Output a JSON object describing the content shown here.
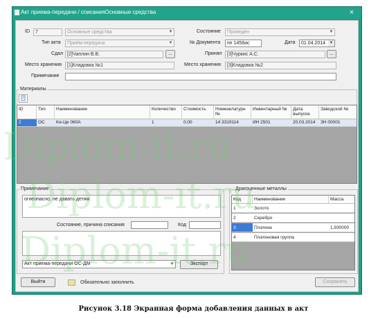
{
  "window": {
    "title": "Акт приема-передачи / списанияОсновные средства",
    "close": "×"
  },
  "form": {
    "id_label": "ID",
    "id_value": "7",
    "type_value": "Основные средства",
    "state_label": "Состояние",
    "state_value": "Проведен",
    "act_type_label": "Тип акта",
    "act_type_value": "Приём-передача",
    "doc_no_label": "№ Документа",
    "doc_no_value": "пп 1456ис",
    "date_label": "Дата",
    "date_value": "01.04.2014",
    "handed_label": "Сдал",
    "handed_value": "[2]Чаплин В.В.",
    "received_label": "Принял",
    "received_value": "[3]Чуркис А.С.",
    "storage_from_label": "Место хранения",
    "storage_from_value": "[1]Кладовка №1",
    "storage_to_label": "Место хранения",
    "storage_to_value": "[3]Кладовка №2",
    "note_label": "Примечание",
    "note_value": "",
    "dots": "..."
  },
  "materials": {
    "group_label": "Материалы",
    "columns": [
      "ID",
      "Тип",
      "Наименование",
      "Количество",
      "Стоимость",
      "Номенклатурн №",
      "Инвентарный №",
      "Дата выпуска",
      "Заводской №"
    ],
    "rows": [
      [
        "2",
        "ОС",
        "Ke-Цe 060А",
        "1",
        "0,00",
        "14 3319114",
        "ИН 2501",
        "20.03.2014",
        "ЗН 00001"
      ]
    ]
  },
  "note_group": {
    "label": "Примечание",
    "text": "огнеопасно, не давать детям",
    "reason_label": "Состояние, причина списания",
    "reason_value": "",
    "code_label": "Код",
    "code_value": "",
    "export_select": "Акт приема-передачи ОС-ДМ",
    "export_button": "Экспорт"
  },
  "metals": {
    "group_label": "Драгоценные металлы",
    "columns": [
      "Код",
      "Наименование",
      "Масса"
    ],
    "rows": [
      [
        "1",
        "Золото",
        ""
      ],
      [
        "2",
        "Серебро",
        ""
      ],
      [
        "3",
        "Платина",
        "1,930000"
      ],
      [
        "4",
        "Платиновая группа",
        ""
      ]
    ]
  },
  "footer": {
    "exit_button": "Выйти",
    "required_text": "Обязательно заполнить",
    "save_button": "Сохранить"
  },
  "caption": "Рисунок 3.18 Экранная форма добавления данных в акт",
  "watermark": "Diplom-it.ru",
  "colors": {
    "titlebar": "#22a38b",
    "selected": "#3c7bd6",
    "required": "#e8e0b4"
  }
}
